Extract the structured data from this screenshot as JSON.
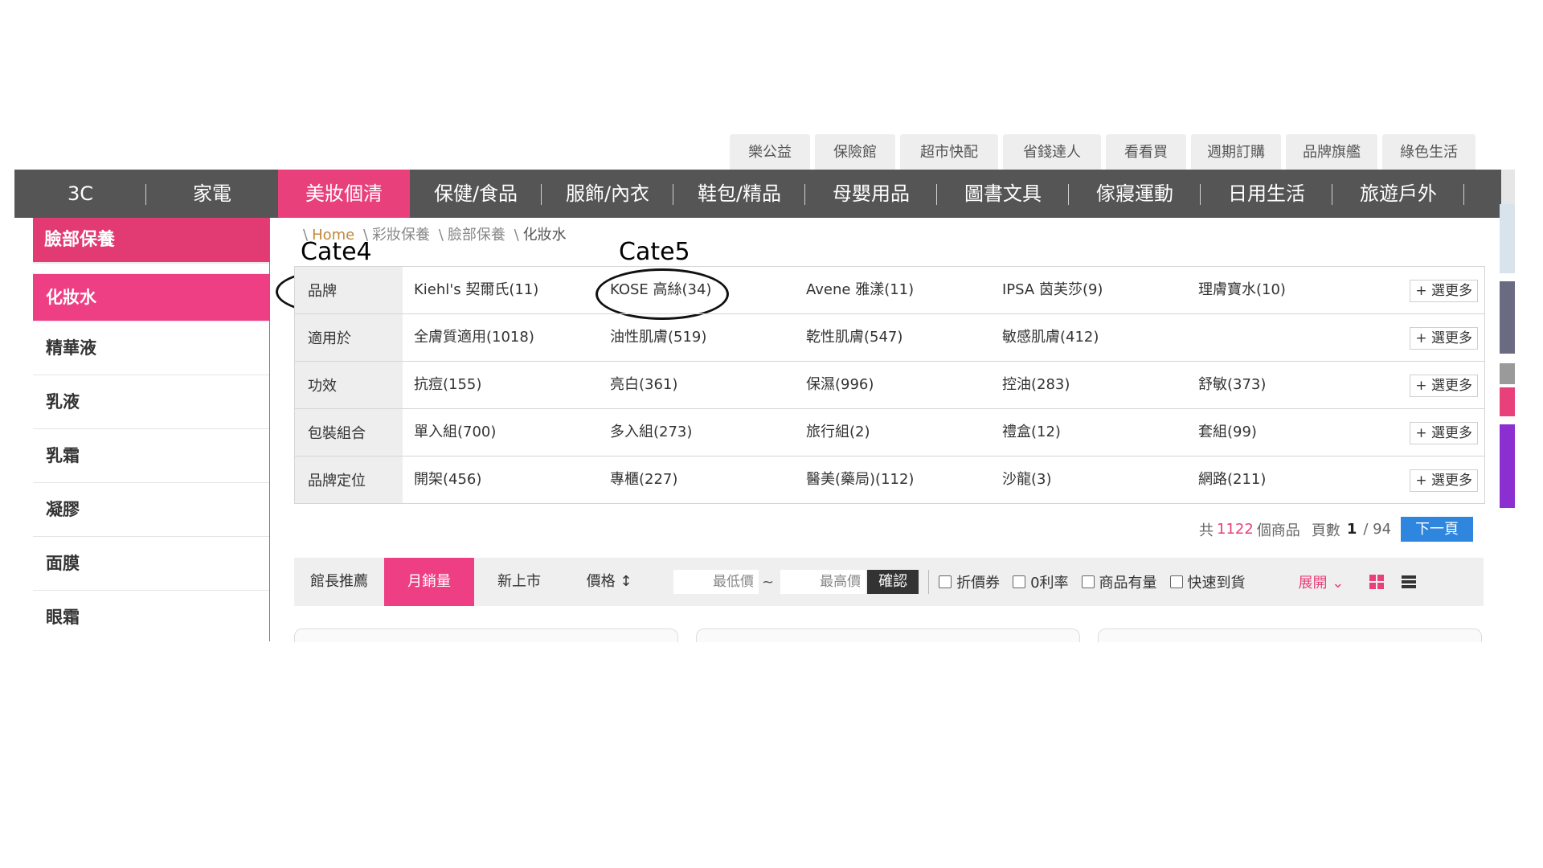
{
  "top_tabs": [
    "樂公益",
    "保險館",
    "超市快配",
    "省錢達人",
    "看看買",
    "週期訂購",
    "品牌旗艦",
    "綠色生活"
  ],
  "main_nav": {
    "items": [
      "3C",
      "家電",
      "美妝個清",
      "保健/食品",
      "服飾/內衣",
      "鞋包/精品",
      "母嬰用品",
      "圖書文具",
      "傢寢運動",
      "日用生活",
      "旅遊戶外"
    ],
    "active_index": 2
  },
  "sidebar": {
    "header": "臉部保養",
    "items": [
      "化妝水",
      "精華液",
      "乳液",
      "乳霜",
      "凝膠",
      "面膜",
      "眼霜"
    ],
    "active_index": 0
  },
  "breadcrumb": [
    "Home",
    "彩妝保養",
    "臉部保養",
    "化妝水"
  ],
  "annotations": {
    "cate4": "Cate4",
    "cate5": "Cate5"
  },
  "filters": [
    {
      "label": "品牌",
      "options": [
        "Kiehl's 契爾氏(11)",
        "KOSE 高絲(34)",
        "Avene 雅漾(11)",
        "IPSA 茵芙莎(9)",
        "理膚寶水(10)"
      ],
      "more": "+ 選更多"
    },
    {
      "label": "適用於",
      "options": [
        "全膚質適用(1018)",
        "油性肌膚(519)",
        "乾性肌膚(547)",
        "敏感肌膚(412)",
        ""
      ],
      "more": "+ 選更多"
    },
    {
      "label": "功效",
      "options": [
        "抗痘(155)",
        "亮白(361)",
        "保濕(996)",
        "控油(283)",
        "舒敏(373)"
      ],
      "more": "+ 選更多"
    },
    {
      "label": "包裝組合",
      "options": [
        "單入組(700)",
        "多入組(273)",
        "旅行組(2)",
        "禮盒(12)",
        "套組(99)"
      ],
      "more": "+ 選更多"
    },
    {
      "label": "品牌定位",
      "options": [
        "開架(456)",
        "專櫃(227)",
        "醫美(藥局)(112)",
        "沙龍(3)",
        "網路(211)"
      ],
      "more": "+ 選更多"
    }
  ],
  "pager": {
    "prefix": "共",
    "count": "1122",
    "suffix": "個商品",
    "page_label": "頁數",
    "page": "1",
    "total": "/ 94",
    "next": "下一頁"
  },
  "sortbar": {
    "items": [
      "館長推薦",
      "月銷量",
      "新上市",
      "價格 ↕"
    ],
    "active_index": 1,
    "min_placeholder": "最低價",
    "tilde": "~",
    "max_placeholder": "最高價",
    "confirm": "確認",
    "checkboxes": [
      "折價券",
      "0利率",
      "商品有量",
      "快速到貨"
    ],
    "expand": "展開 ⌄"
  },
  "colors": {
    "accent": "#e8407a",
    "nav_bg": "#555555",
    "next_btn": "#2e86de"
  }
}
